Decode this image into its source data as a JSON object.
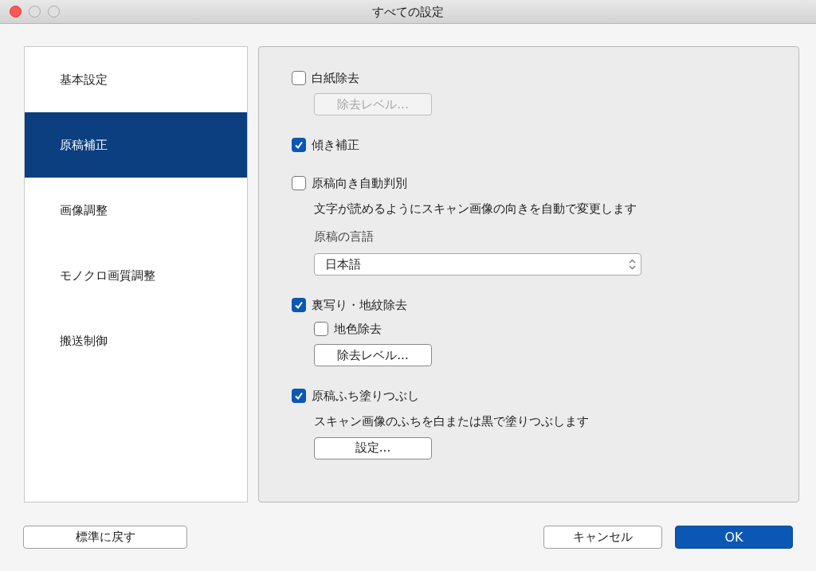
{
  "window": {
    "title": "すべての設定"
  },
  "sidebar": {
    "items": [
      {
        "label": "基本設定",
        "selected": false
      },
      {
        "label": "原稿補正",
        "selected": true
      },
      {
        "label": "画像調整",
        "selected": false
      },
      {
        "label": "モノクロ画質調整",
        "selected": false
      },
      {
        "label": "搬送制御",
        "selected": false
      }
    ]
  },
  "sections": [
    {
      "label": "白紙除去",
      "checked": false,
      "children": [
        {
          "kind": "button",
          "label": "除去レベル...",
          "disabled": true
        }
      ]
    },
    {
      "label": "傾き補正",
      "checked": true
    },
    {
      "label": "原稿向き自動判別",
      "checked": false,
      "children": [
        {
          "kind": "text",
          "label": "文字が読めるようにスキャン画像の向きを自動で変更します"
        },
        {
          "kind": "caption",
          "label": "原稿の言語"
        },
        {
          "kind": "select",
          "value": "日本語"
        }
      ]
    },
    {
      "label": "裏写り・地紋除去",
      "checked": true,
      "children": [
        {
          "kind": "checkbox",
          "label": "地色除去",
          "checked": false
        },
        {
          "kind": "button",
          "label": "除去レベル...",
          "disabled": false
        }
      ]
    },
    {
      "label": "原稿ふち塗りつぶし",
      "checked": true,
      "children": [
        {
          "kind": "text",
          "label": "スキャン画像のふちを白または黒で塗りつぶします"
        },
        {
          "kind": "button",
          "label": "設定...",
          "disabled": false
        }
      ]
    }
  ],
  "footer": {
    "reset_button": "標準に戻す",
    "cancel_button": "キャンセル",
    "ok_button": "OK"
  }
}
